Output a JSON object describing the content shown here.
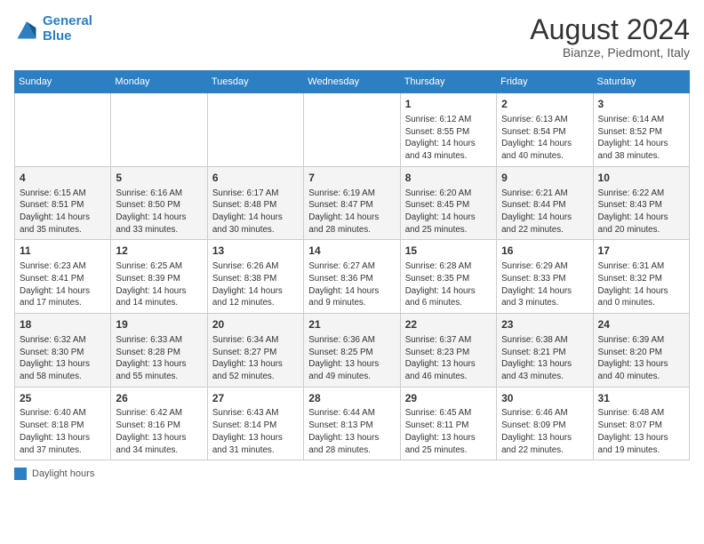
{
  "header": {
    "logo_line1": "General",
    "logo_line2": "Blue",
    "month_year": "August 2024",
    "location": "Bianze, Piedmont, Italy"
  },
  "days_of_week": [
    "Sunday",
    "Monday",
    "Tuesday",
    "Wednesday",
    "Thursday",
    "Friday",
    "Saturday"
  ],
  "legend_label": "Daylight hours",
  "weeks": [
    [
      {
        "day": "",
        "content": ""
      },
      {
        "day": "",
        "content": ""
      },
      {
        "day": "",
        "content": ""
      },
      {
        "day": "",
        "content": ""
      },
      {
        "day": "1",
        "content": "Sunrise: 6:12 AM\nSunset: 8:55 PM\nDaylight: 14 hours and 43 minutes."
      },
      {
        "day": "2",
        "content": "Sunrise: 6:13 AM\nSunset: 8:54 PM\nDaylight: 14 hours and 40 minutes."
      },
      {
        "day": "3",
        "content": "Sunrise: 6:14 AM\nSunset: 8:52 PM\nDaylight: 14 hours and 38 minutes."
      }
    ],
    [
      {
        "day": "4",
        "content": "Sunrise: 6:15 AM\nSunset: 8:51 PM\nDaylight: 14 hours and 35 minutes."
      },
      {
        "day": "5",
        "content": "Sunrise: 6:16 AM\nSunset: 8:50 PM\nDaylight: 14 hours and 33 minutes."
      },
      {
        "day": "6",
        "content": "Sunrise: 6:17 AM\nSunset: 8:48 PM\nDaylight: 14 hours and 30 minutes."
      },
      {
        "day": "7",
        "content": "Sunrise: 6:19 AM\nSunset: 8:47 PM\nDaylight: 14 hours and 28 minutes."
      },
      {
        "day": "8",
        "content": "Sunrise: 6:20 AM\nSunset: 8:45 PM\nDaylight: 14 hours and 25 minutes."
      },
      {
        "day": "9",
        "content": "Sunrise: 6:21 AM\nSunset: 8:44 PM\nDaylight: 14 hours and 22 minutes."
      },
      {
        "day": "10",
        "content": "Sunrise: 6:22 AM\nSunset: 8:43 PM\nDaylight: 14 hours and 20 minutes."
      }
    ],
    [
      {
        "day": "11",
        "content": "Sunrise: 6:23 AM\nSunset: 8:41 PM\nDaylight: 14 hours and 17 minutes."
      },
      {
        "day": "12",
        "content": "Sunrise: 6:25 AM\nSunset: 8:39 PM\nDaylight: 14 hours and 14 minutes."
      },
      {
        "day": "13",
        "content": "Sunrise: 6:26 AM\nSunset: 8:38 PM\nDaylight: 14 hours and 12 minutes."
      },
      {
        "day": "14",
        "content": "Sunrise: 6:27 AM\nSunset: 8:36 PM\nDaylight: 14 hours and 9 minutes."
      },
      {
        "day": "15",
        "content": "Sunrise: 6:28 AM\nSunset: 8:35 PM\nDaylight: 14 hours and 6 minutes."
      },
      {
        "day": "16",
        "content": "Sunrise: 6:29 AM\nSunset: 8:33 PM\nDaylight: 14 hours and 3 minutes."
      },
      {
        "day": "17",
        "content": "Sunrise: 6:31 AM\nSunset: 8:32 PM\nDaylight: 14 hours and 0 minutes."
      }
    ],
    [
      {
        "day": "18",
        "content": "Sunrise: 6:32 AM\nSunset: 8:30 PM\nDaylight: 13 hours and 58 minutes."
      },
      {
        "day": "19",
        "content": "Sunrise: 6:33 AM\nSunset: 8:28 PM\nDaylight: 13 hours and 55 minutes."
      },
      {
        "day": "20",
        "content": "Sunrise: 6:34 AM\nSunset: 8:27 PM\nDaylight: 13 hours and 52 minutes."
      },
      {
        "day": "21",
        "content": "Sunrise: 6:36 AM\nSunset: 8:25 PM\nDaylight: 13 hours and 49 minutes."
      },
      {
        "day": "22",
        "content": "Sunrise: 6:37 AM\nSunset: 8:23 PM\nDaylight: 13 hours and 46 minutes."
      },
      {
        "day": "23",
        "content": "Sunrise: 6:38 AM\nSunset: 8:21 PM\nDaylight: 13 hours and 43 minutes."
      },
      {
        "day": "24",
        "content": "Sunrise: 6:39 AM\nSunset: 8:20 PM\nDaylight: 13 hours and 40 minutes."
      }
    ],
    [
      {
        "day": "25",
        "content": "Sunrise: 6:40 AM\nSunset: 8:18 PM\nDaylight: 13 hours and 37 minutes."
      },
      {
        "day": "26",
        "content": "Sunrise: 6:42 AM\nSunset: 8:16 PM\nDaylight: 13 hours and 34 minutes."
      },
      {
        "day": "27",
        "content": "Sunrise: 6:43 AM\nSunset: 8:14 PM\nDaylight: 13 hours and 31 minutes."
      },
      {
        "day": "28",
        "content": "Sunrise: 6:44 AM\nSunset: 8:13 PM\nDaylight: 13 hours and 28 minutes."
      },
      {
        "day": "29",
        "content": "Sunrise: 6:45 AM\nSunset: 8:11 PM\nDaylight: 13 hours and 25 minutes."
      },
      {
        "day": "30",
        "content": "Sunrise: 6:46 AM\nSunset: 8:09 PM\nDaylight: 13 hours and 22 minutes."
      },
      {
        "day": "31",
        "content": "Sunrise: 6:48 AM\nSunset: 8:07 PM\nDaylight: 13 hours and 19 minutes."
      }
    ]
  ]
}
